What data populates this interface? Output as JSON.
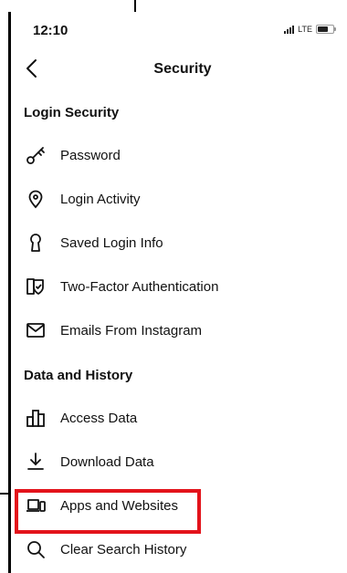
{
  "status_bar": {
    "time": "12:10",
    "network": "LTE"
  },
  "nav": {
    "title": "Security"
  },
  "sections": [
    {
      "header": "Login Security"
    },
    {
      "header": "Data and History"
    }
  ],
  "items": [
    {
      "label": "Password",
      "icon": "key-icon"
    },
    {
      "label": "Login Activity",
      "icon": "location-pin-icon"
    },
    {
      "label": "Saved Login Info",
      "icon": "keyhole-icon"
    },
    {
      "label": "Two-Factor Authentication",
      "icon": "shield-check-icon"
    },
    {
      "label": "Emails From Instagram",
      "icon": "envelope-icon"
    },
    {
      "label": "Access Data",
      "icon": "bar-chart-icon"
    },
    {
      "label": "Download Data",
      "icon": "download-icon"
    },
    {
      "label": "Apps and Websites",
      "icon": "devices-icon"
    },
    {
      "label": "Clear Search History",
      "icon": "search-icon"
    }
  ],
  "highlight": {
    "color": "#e3131b",
    "target": "Apps and Websites"
  }
}
